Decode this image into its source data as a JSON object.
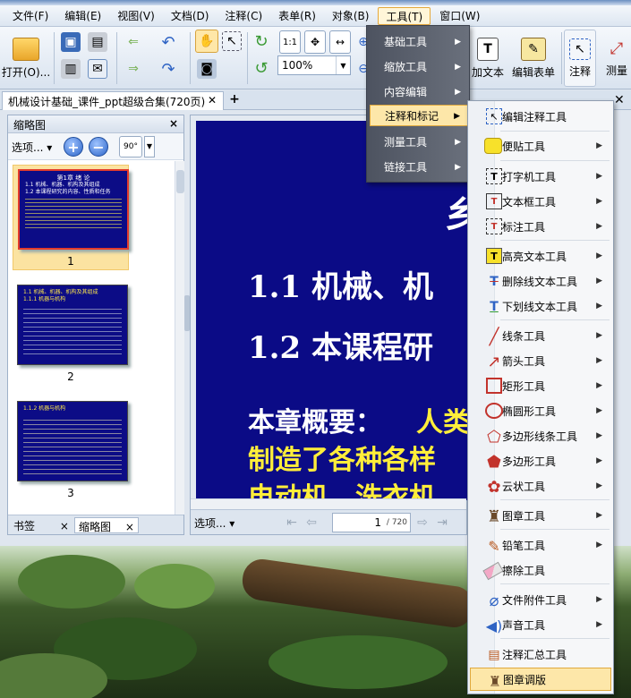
{
  "menubar": {
    "items": [
      "文件(F)",
      "编辑(E)",
      "视图(V)",
      "文档(D)",
      "注释(C)",
      "表单(R)",
      "对象(B)",
      "工具(T)",
      "窗口(W)"
    ],
    "active_index": 7
  },
  "toolbar": {
    "open_label": "打开(O)...",
    "zoom_value": "100%",
    "zoom_fit_label": "1:1",
    "add_text_label": "加文本",
    "edit_form_label": "编辑表单",
    "annotate_label": "注释",
    "measure_label": "测量"
  },
  "tabs": {
    "doc_title": "机械设计基础_课件_ppt超级合集(720页)"
  },
  "left_panel": {
    "title": "缩略图",
    "options_label": "选项...",
    "rotate_label": "90°",
    "thumbnails": [
      {
        "number": "1",
        "lines": [
          "第1章 绪 论",
          "1.1 机械、机器、机构及其组成",
          "1.2 本课程研究的内容、性质和任务"
        ]
      },
      {
        "number": "2",
        "lines": [
          "1.1 机械、机器、机构及其组成",
          "1.1.1 机器与机构"
        ]
      },
      {
        "number": "3",
        "lines": [
          "1.1.2 机器与机构"
        ]
      }
    ],
    "bottom_tabs": [
      "书签",
      "缩略图"
    ]
  },
  "document": {
    "slide_lines": [
      {
        "text": "1.1  机械、机",
        "color": "#ffffff"
      },
      {
        "text": "1.2  本课程研",
        "color": "#ffffff"
      },
      {
        "text": "本章概要：",
        "color": "#ffffff"
      },
      {
        "text": "人类",
        "color": "#ffee3a"
      },
      {
        "text": "制造了各种各样",
        "color": "#ffee3a"
      },
      {
        "text": "电动机、洗衣机",
        "color": "#ffee3a"
      }
    ],
    "options_label": "选项...",
    "page_current": "1",
    "page_total": "/ 720"
  },
  "tools_menu": {
    "items": [
      "基础工具",
      "缩放工具",
      "内容编辑",
      "注释和标记",
      "测量工具",
      "链接工具"
    ],
    "highlighted_index": 3
  },
  "annot_submenu": {
    "items": [
      {
        "label": "编辑注释工具",
        "icon": "edit-annotation-icon",
        "arrow": false
      },
      {
        "label": "便贴工具",
        "icon": "sticky-note-icon",
        "arrow": true
      },
      {
        "label": "打字机工具",
        "icon": "typewriter-icon",
        "arrow": true
      },
      {
        "label": "文本框工具",
        "icon": "textbox-icon",
        "arrow": true
      },
      {
        "label": "标注工具",
        "icon": "callout-icon",
        "arrow": true
      },
      {
        "label": "高亮文本工具",
        "icon": "highlight-icon",
        "arrow": true
      },
      {
        "label": "删除线文本工具",
        "icon": "strikeout-icon",
        "arrow": true
      },
      {
        "label": "下划线文本工具",
        "icon": "underline-icon",
        "arrow": true
      },
      {
        "label": "线条工具",
        "icon": "line-icon",
        "arrow": true
      },
      {
        "label": "箭头工具",
        "icon": "arrow-icon",
        "arrow": true
      },
      {
        "label": "矩形工具",
        "icon": "rectangle-icon",
        "arrow": true
      },
      {
        "label": "椭圆形工具",
        "icon": "ellipse-icon",
        "arrow": true
      },
      {
        "label": "多边形线条工具",
        "icon": "polyline-icon",
        "arrow": true
      },
      {
        "label": "多边形工具",
        "icon": "polygon-icon",
        "arrow": true
      },
      {
        "label": "云状工具",
        "icon": "cloud-icon",
        "arrow": true
      },
      {
        "label": "图章工具",
        "icon": "stamp-icon",
        "arrow": true
      },
      {
        "label": "铅笔工具",
        "icon": "pencil-icon",
        "arrow": true
      },
      {
        "label": "擦除工具",
        "icon": "eraser-icon",
        "arrow": false
      },
      {
        "label": "文件附件工具",
        "icon": "attachment-icon",
        "arrow": true
      },
      {
        "label": "声音工具",
        "icon": "sound-icon",
        "arrow": true
      },
      {
        "label": "注释汇总工具",
        "icon": "summary-icon",
        "arrow": false
      },
      {
        "label": "图章调版",
        "icon": "stamp-palette-icon",
        "arrow": false
      }
    ],
    "highlighted_index": 21
  }
}
